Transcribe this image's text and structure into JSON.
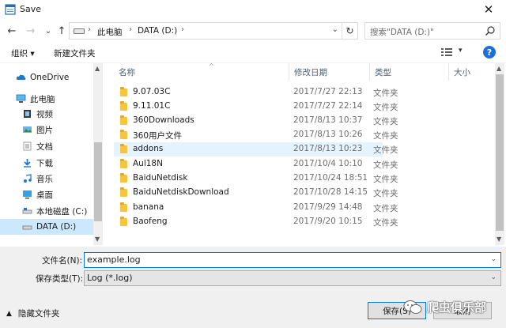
{
  "window": {
    "title": "Save",
    "close_glyph": "✕"
  },
  "address": {
    "crumbs": [
      "此电脑",
      "DATA (D:)"
    ],
    "search_placeholder": "搜索\"DATA (D:)\""
  },
  "nav_glyphs": {
    "back": "←",
    "forward": "→",
    "recent": "⌄",
    "up": "↑",
    "crumb_sep": "›",
    "refresh": "↻",
    "dropdown": "⌄"
  },
  "toolbar": {
    "organize": "组织 ▾",
    "new_folder": "新建文件夹",
    "view_dd": "▾",
    "help": "?"
  },
  "sidebar": {
    "items": [
      {
        "label": "OneDrive",
        "icon": "cloud-icon"
      },
      {
        "label": "此电脑",
        "icon": "computer-icon"
      },
      {
        "label": "视频",
        "icon": "video-icon"
      },
      {
        "label": "图片",
        "icon": "picture-icon"
      },
      {
        "label": "文档",
        "icon": "document-icon"
      },
      {
        "label": "下载",
        "icon": "download-icon"
      },
      {
        "label": "音乐",
        "icon": "music-icon"
      },
      {
        "label": "桌面",
        "icon": "desktop-icon"
      },
      {
        "label": "本地磁盘 (C:)",
        "icon": "drive-icon"
      },
      {
        "label": "DATA (D:)",
        "icon": "drive-icon",
        "selected": true
      }
    ]
  },
  "columns": [
    "名称",
    "修改日期",
    "类型",
    "大小"
  ],
  "files": [
    {
      "name": "9.07.03C",
      "date": "2017/7/27 22:13",
      "type": "文件夹"
    },
    {
      "name": "9.11.01C",
      "date": "2017/7/27 22:14",
      "type": "文件夹"
    },
    {
      "name": "360Downloads",
      "date": "2017/8/13 10:37",
      "type": "文件夹"
    },
    {
      "name": "360用户文件",
      "date": "2017/8/13 10:26",
      "type": "文件夹"
    },
    {
      "name": "addons",
      "date": "2017/8/13 10:23",
      "type": "文件夹",
      "selected": true
    },
    {
      "name": "Aul18N",
      "date": "2017/10/4 10:10",
      "type": "文件夹"
    },
    {
      "name": "BaiduNetdisk",
      "date": "2017/10/24 18:51",
      "type": "文件夹"
    },
    {
      "name": "BaiduNetdiskDownload",
      "date": "2017/10/28 14:15",
      "type": "文件夹"
    },
    {
      "name": "banana",
      "date": "2017/9/29 14:48",
      "type": "文件夹"
    },
    {
      "name": "Baofeng",
      "date": "2017/9/20 10:15",
      "type": "文件夹"
    }
  ],
  "form": {
    "filename_label": "文件名(N):",
    "filename_value": "example.log",
    "filetype_label": "保存类型(T):",
    "filetype_value": "Log (*.log)"
  },
  "footer": {
    "hide_folders": "隐藏文件夹",
    "save": "保存(S)",
    "cancel": "取消",
    "watermark_text": "爬虫俱乐部"
  },
  "colors": {
    "accent": "#0078d7",
    "selected_bg": "#cce8ff",
    "hover_bg": "#e5f3ff",
    "folder": "#f5c542"
  }
}
